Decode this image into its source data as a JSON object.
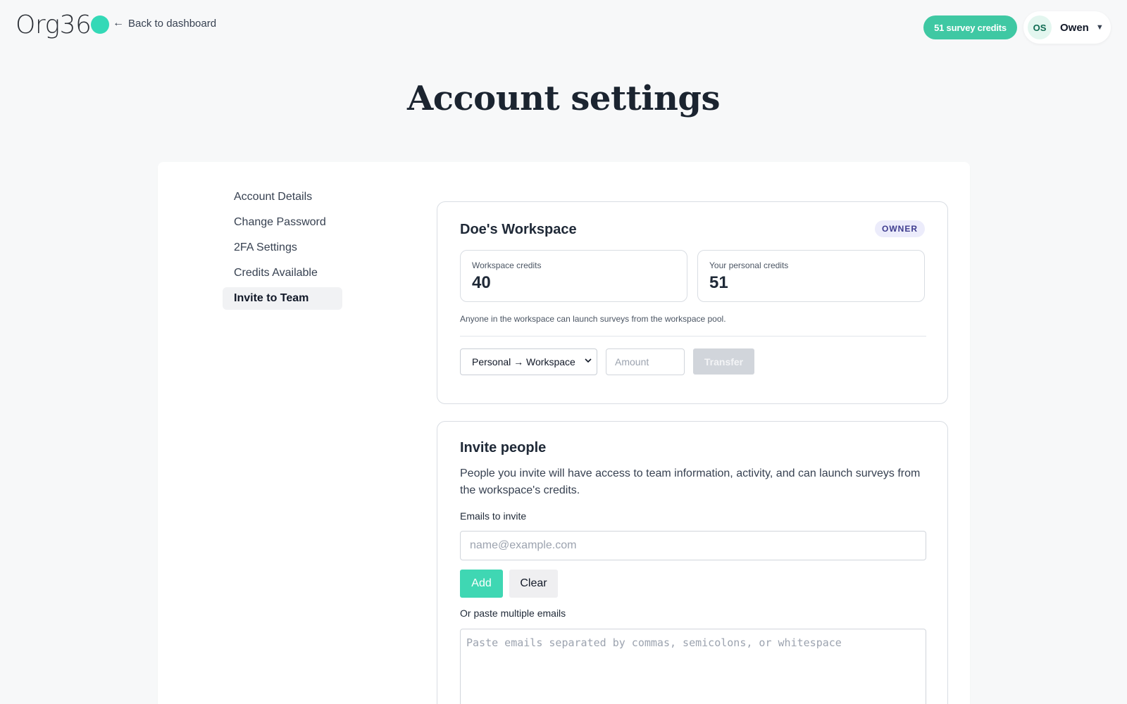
{
  "brand": {
    "name": "Org36",
    "accent": "#34d9b7"
  },
  "nav_top": {
    "back_label": "Back to dashboard",
    "credits_pill": "51 survey credits"
  },
  "user": {
    "initials": "OS",
    "name": "Owen",
    "menu_icon": "chevron-down-icon"
  },
  "page": {
    "title": "Account settings"
  },
  "sidebar": {
    "items": [
      {
        "label": "Account Details"
      },
      {
        "label": "Change Password"
      },
      {
        "label": "2FA Settings"
      },
      {
        "label": "Credits Available"
      },
      {
        "label": "Invite to Team",
        "active": true
      }
    ]
  },
  "workspace": {
    "name": "Doe's Workspace",
    "role": "OWNER",
    "workspace_credits_label": "Workspace credits",
    "workspace_credits_value": "40",
    "personal_credits_label": "Your personal credits",
    "personal_credits_value": "51",
    "note": "Anyone in the workspace can launch surveys from the workspace pool.",
    "transfer_direction": "Personal → Workspace",
    "amount_placeholder": "Amount",
    "transfer_label": "Transfer"
  },
  "invite": {
    "title": "Invite people",
    "description": "People you invite will have access to team information, activity, and can launch surveys from the workspace's credits.",
    "emails_label": "Emails to invite",
    "email_placeholder": "name@example.com",
    "add_label": "Add",
    "clear_label": "Clear",
    "paste_label": "Or paste multiple emails",
    "paste_placeholder": "Paste emails separated by commas, semicolons, or whitespace"
  }
}
